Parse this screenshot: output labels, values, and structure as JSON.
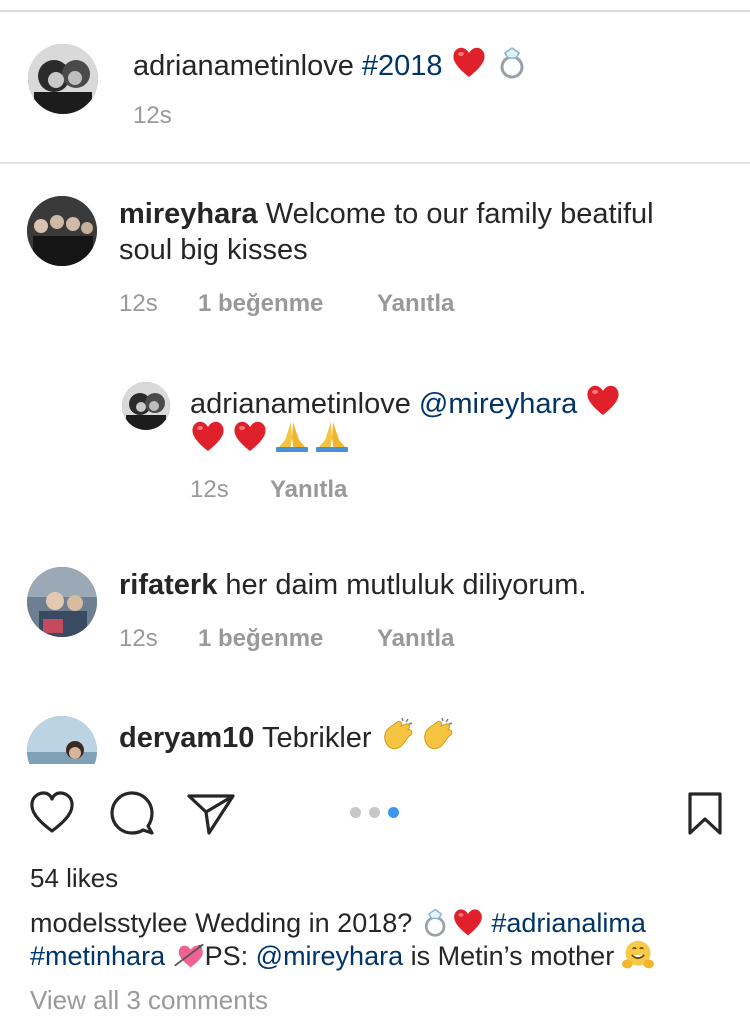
{
  "post_header": {
    "username": "adrianametinlove",
    "hashtag": "#2018",
    "emojis": [
      "heart-emoji",
      "ring-emoji"
    ],
    "time": "12s"
  },
  "comments": [
    {
      "username": "mireyhara",
      "text_line1": "Welcome to our family beatiful",
      "text_line2": "soul big kisses",
      "time": "12s",
      "likes": "1 beğenme",
      "reply": "Yanıtla"
    },
    {
      "username": "adrianametinlove",
      "mention": "@mireyhara",
      "emojis": [
        "heart-emoji",
        "heart-emoji",
        "heart-emoji",
        "pray-emoji",
        "pray-emoji"
      ],
      "time": "12s",
      "reply": "Yanıtla"
    },
    {
      "username": "rifaterk",
      "text": "her daim mutluluk diliyorum.",
      "time": "12s",
      "likes": "1 beğenme",
      "reply": "Yanıtla"
    },
    {
      "username": "deryam10",
      "text": "Tebrikler",
      "emojis": [
        "clap-emoji",
        "clap-emoji"
      ]
    }
  ],
  "actions": {
    "icons": [
      "heart-icon",
      "comment-icon",
      "share-icon",
      "bookmark-icon"
    ],
    "carousel_dots": 3,
    "active_dot": 3
  },
  "likes_text": "54 likes",
  "caption": {
    "username": "modelsstylee",
    "text1": "Wedding in 2018?",
    "hashtag1": "#adrianalima",
    "hashtag2": "#metinhara",
    "text2": "PS:",
    "mention": "@mireyhara",
    "text3": "is Metin’s mother"
  },
  "view_all_comments": "View all 3 comments",
  "colors": {
    "link": "#003569",
    "meta": "#999999",
    "active_dot": "#3897f0",
    "text": "#262626"
  }
}
